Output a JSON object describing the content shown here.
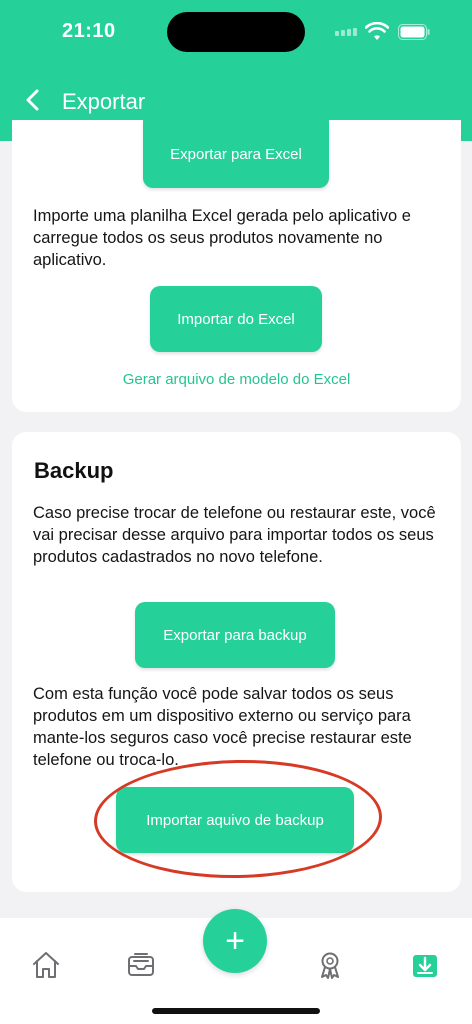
{
  "status": {
    "time": "21:10"
  },
  "header": {
    "title": "Exportar"
  },
  "excel_section": {
    "export_button": "Exportar para Excel",
    "description": "Importe uma planilha Excel gerada pelo aplicativo e carregue todos os seus produtos novamente no aplicativo.",
    "import_button": "Importar do Excel",
    "template_link": "Gerar arquivo de modelo do Excel"
  },
  "backup_section": {
    "title": "Backup",
    "description1": "Caso precise trocar de telefone ou restaurar este, você vai precisar desse arquivo para importar todos os seus produtos cadastrados no novo telefone.",
    "export_button": "Exportar para backup",
    "description2": "Com esta função você pode salvar todos os seus produtos em um dispositivo externo ou serviço para mante-los seguros caso você precise restaurar este telefone ou troca-lo.",
    "import_button": "Importar aquivo de backup"
  },
  "tabbar": {
    "fab_label": "+",
    "tabs": [
      "home-icon",
      "inbox-icon",
      "award-icon",
      "download-icon"
    ],
    "accent": "#26d199"
  },
  "colors": {
    "brand": "#26d199",
    "annotation": "#d63a25"
  }
}
